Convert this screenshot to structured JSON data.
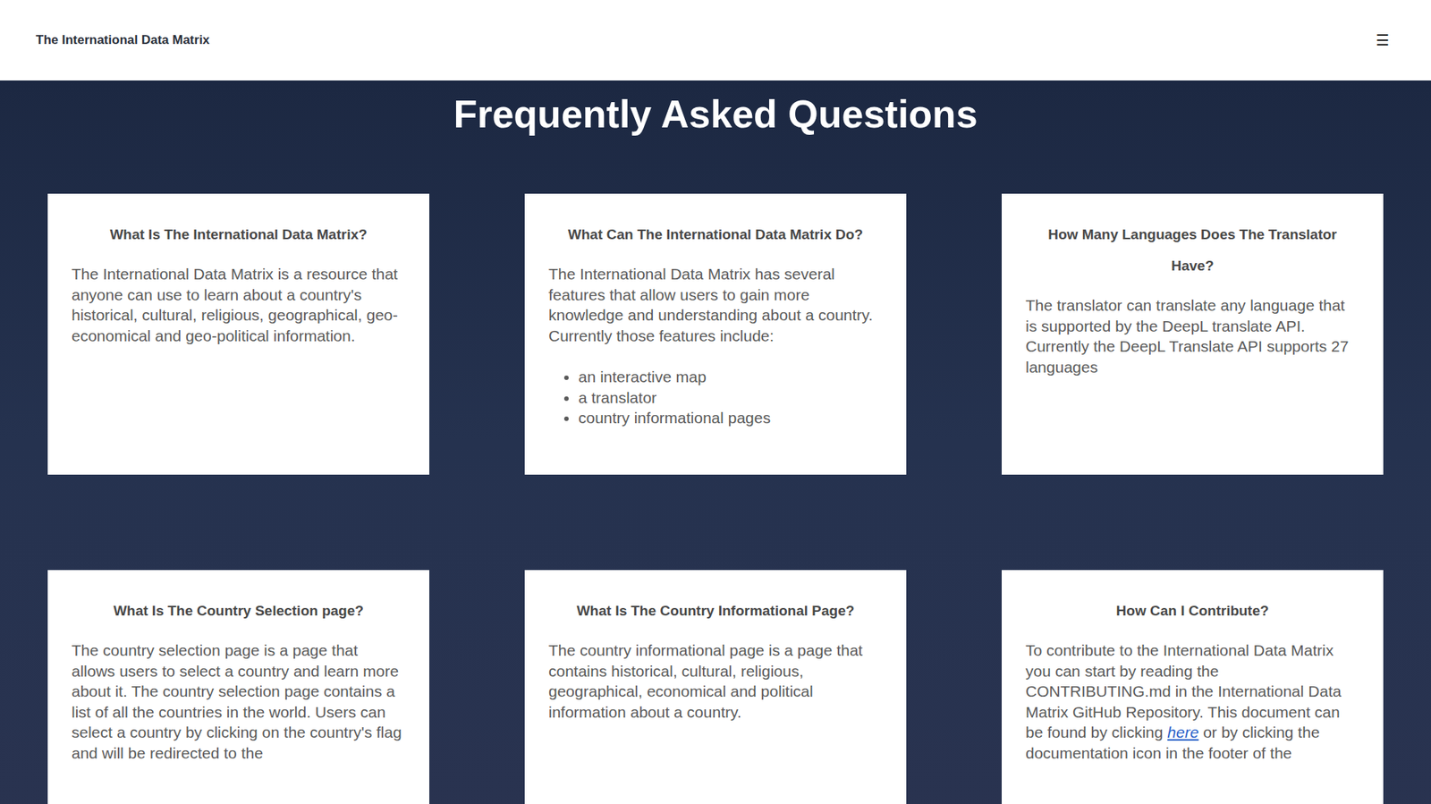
{
  "header": {
    "brand": "The International Data Matrix",
    "menu_icon": "☰"
  },
  "title": "Frequently Asked Questions",
  "faqs": [
    {
      "question": "What Is The International Data Matrix?",
      "parts": [
        {
          "text": "The International Data Matrix is a resource that anyone can use to learn about a country's historical, cultural, religious, geographical, geo-economical and geo-political information.",
          "link": false
        }
      ],
      "items": []
    },
    {
      "question": "What Can The International Data Matrix Do?",
      "parts": [
        {
          "text": "The International Data Matrix has several features that allow users to gain more knowledge and understanding about a country. Currently those features include:",
          "link": false
        }
      ],
      "items": [
        "an interactive map",
        "a translator",
        "country informational pages"
      ]
    },
    {
      "question": "How Many Languages Does The Translator Have?",
      "parts": [
        {
          "text": "The translator can translate any language that is supported by the DeepL translate API. Currently the DeepL Translate API supports 27 languages",
          "link": false
        }
      ],
      "items": []
    },
    {
      "question": "What Is The Country Selection page?",
      "parts": [
        {
          "text": "The country selection page is a page that allows users to select a country and learn more about it. The country selection page contains a list of all the countries in the world. Users can select a country by clicking on the country's flag and will be redirected to the",
          "link": false
        }
      ],
      "items": []
    },
    {
      "question": "What Is The Country Informational Page?",
      "parts": [
        {
          "text": "The country informational page is a page that contains historical, cultural, religious, geographical, economical and political information about a country.",
          "link": false
        }
      ],
      "items": []
    },
    {
      "question": "How Can I Contribute?",
      "parts": [
        {
          "text": "To contribute to the International Data Matrix you can start by reading the CONTRIBUTING.md in the International Data Matrix GitHub Repository. This document can be found by clicking ",
          "link": false
        },
        {
          "text": "here",
          "link": true
        },
        {
          "text": " or by clicking the documentation icon in the footer of the",
          "link": false
        }
      ],
      "items": []
    }
  ]
}
